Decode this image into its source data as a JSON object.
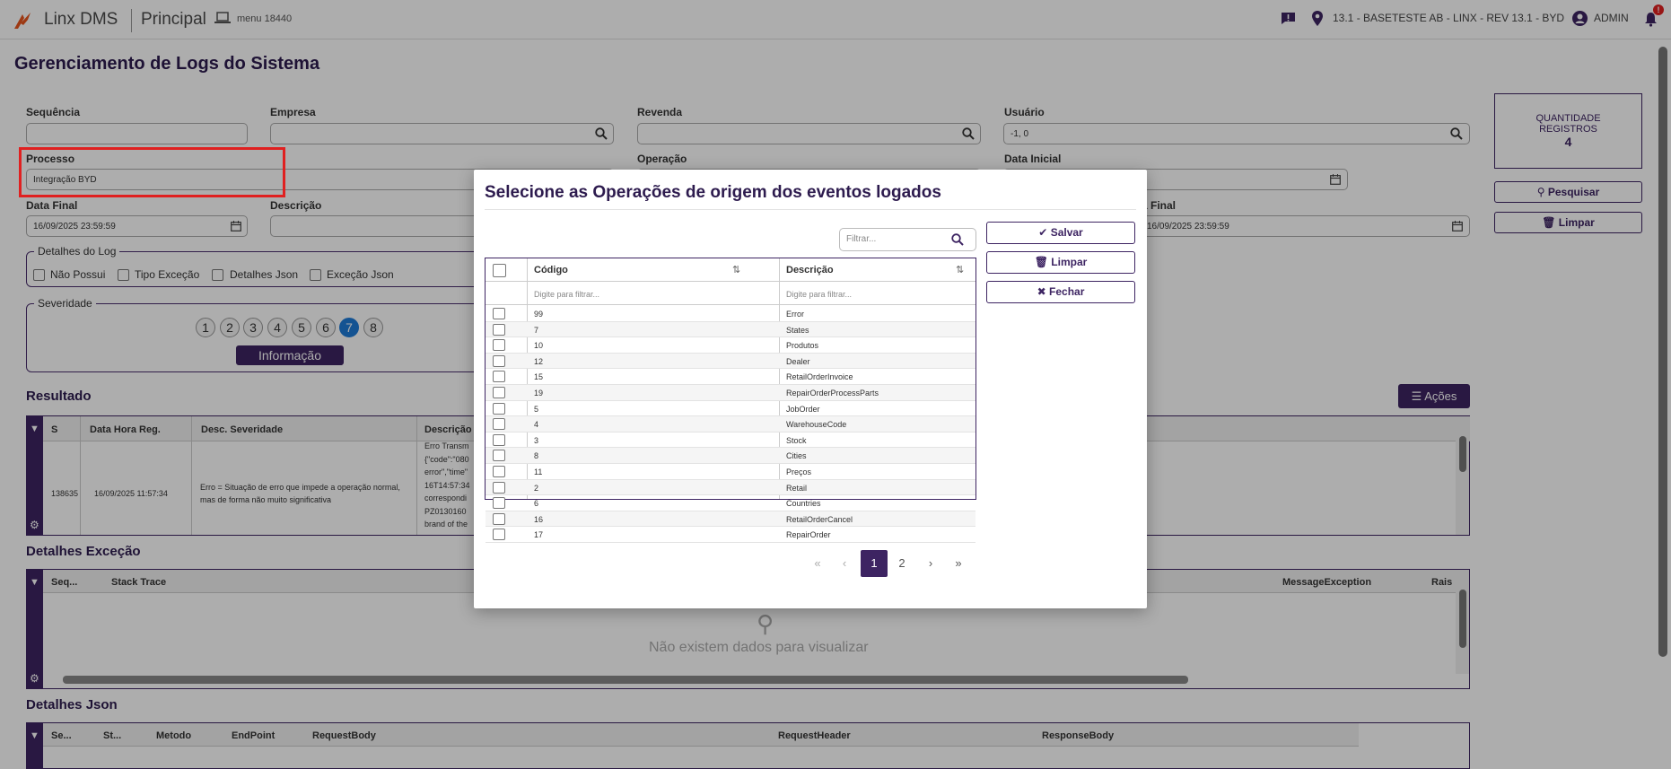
{
  "topbar": {
    "app_name": "Linx DMS",
    "module": "Principal",
    "menu_id": "menu 18440",
    "store": "13.1 - BASETESTE AB - LINX - REV 13.1 - BYD",
    "user": "ADMIN",
    "notification_badge": "!"
  },
  "page": {
    "title": "Gerenciamento de Logs do Sistema"
  },
  "filters": {
    "sequencia": {
      "label": "Sequência",
      "value": ""
    },
    "empresa": {
      "label": "Empresa",
      "value": ""
    },
    "revenda": {
      "label": "Revenda",
      "value": ""
    },
    "usuario": {
      "label": "Usuário",
      "value": "-1, 0"
    },
    "processo": {
      "label": "Processo",
      "value": "Integração BYD"
    },
    "operacao": {
      "label": "Operação",
      "value": ""
    },
    "data_inicial": {
      "label": "Data Inicial",
      "value": ""
    },
    "data_final": {
      "label": "Data Final",
      "value": "16/09/2025 23:59:59"
    },
    "descricao": {
      "label": "Descrição",
      "value": ""
    },
    "data_final_2": {
      "label": "a Final",
      "value": "16/09/2025 23:59:59"
    }
  },
  "detalhes_log": {
    "legend": "Detalhes do Log",
    "options": [
      "Não Possui",
      "Tipo Exceção",
      "Detalhes Json",
      "Exceção Json"
    ]
  },
  "severidade": {
    "legend": "Severidade",
    "levels": [
      "1",
      "2",
      "3",
      "4",
      "5",
      "6",
      "7",
      "8"
    ],
    "selected": "7",
    "selected_label": "Informação"
  },
  "quantidade": {
    "label_line1": "QUANTIDADE",
    "label_line2": "REGISTROS",
    "value": "4"
  },
  "side_buttons": {
    "pesquisar": "Pesquisar",
    "limpar": "Limpar"
  },
  "resultado": {
    "title": "Resultado",
    "acoes": "Ações",
    "columns": [
      "S",
      "Data Hora Reg.",
      "Desc. Severidade",
      "Descrição"
    ],
    "row": {
      "seq": "138635",
      "data": "16/09/2025 11:57:34",
      "severidade": "Erro = Situação de erro que impede a operação normal, mas de forma não muito significativa",
      "descricao": [
        "Erro Transm",
        "{\"code\":\"080",
        "error\",\"time\"",
        "16T14:57:34",
        "correspondi",
        "PZ0130160",
        "brand of the"
      ]
    }
  },
  "detalhes_excecao": {
    "title": "Detalhes Exceção",
    "columns": [
      "Seq...",
      "Stack Trace",
      "MessageException",
      "Rais"
    ],
    "empty": "Não existem dados para visualizar"
  },
  "detalhes_json": {
    "title": "Detalhes Json",
    "columns": [
      "Se...",
      "St...",
      "Metodo",
      "EndPoint",
      "RequestBody",
      "RequestHeader",
      "ResponseBody"
    ]
  },
  "modal": {
    "title": "Selecione as Operações de origem dos eventos logados",
    "filter_placeholder": "Filtrar...",
    "buttons": {
      "salvar": "Salvar",
      "limpar": "Limpar",
      "fechar": "Fechar"
    },
    "columns": {
      "codigo": "Código",
      "descricao": "Descrição"
    },
    "col_filter_placeholder": "Digite para filtrar...",
    "rows": [
      {
        "codigo": "99",
        "descricao": "Error"
      },
      {
        "codigo": "7",
        "descricao": "States"
      },
      {
        "codigo": "10",
        "descricao": "Produtos"
      },
      {
        "codigo": "12",
        "descricao": "Dealer"
      },
      {
        "codigo": "15",
        "descricao": "RetailOrderInvoice"
      },
      {
        "codigo": "19",
        "descricao": "RepairOrderProcessParts"
      },
      {
        "codigo": "5",
        "descricao": "JobOrder"
      },
      {
        "codigo": "4",
        "descricao": "WarehouseCode"
      },
      {
        "codigo": "3",
        "descricao": "Stock"
      },
      {
        "codigo": "8",
        "descricao": "Cities"
      },
      {
        "codigo": "11",
        "descricao": "Preços"
      },
      {
        "codigo": "2",
        "descricao": "Retail"
      },
      {
        "codigo": "6",
        "descricao": "Countries"
      },
      {
        "codigo": "16",
        "descricao": "RetailOrderCancel"
      },
      {
        "codigo": "17",
        "descricao": "RepairOrder"
      }
    ],
    "pagination": {
      "first": "«",
      "prev": "‹",
      "pages": [
        "1",
        "2"
      ],
      "current": "1",
      "next": "›",
      "last": "»"
    }
  },
  "colors": {
    "primary": "#3d2462",
    "accent": "#1e7bd8",
    "highlight": "#e02020"
  }
}
